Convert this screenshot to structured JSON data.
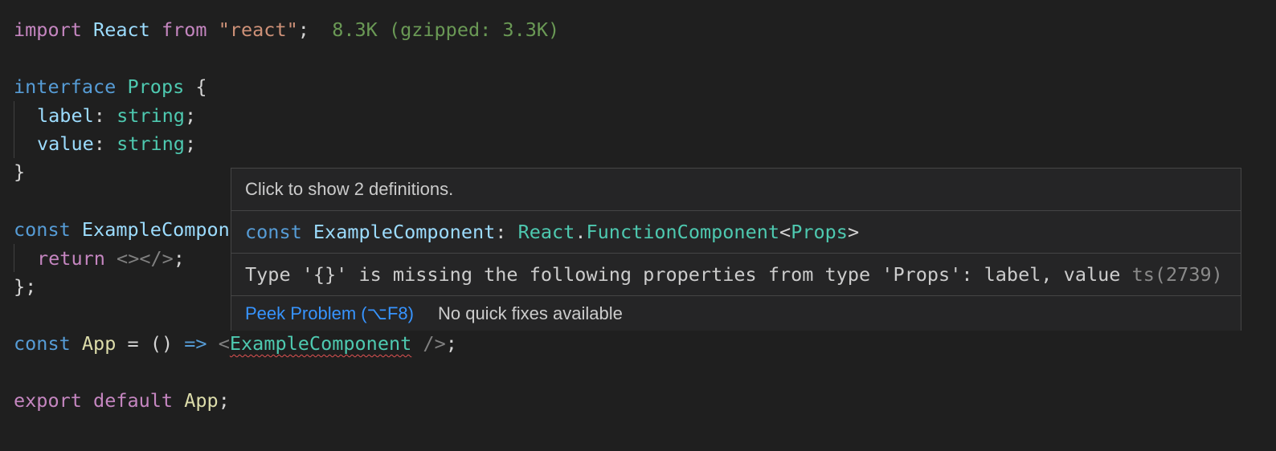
{
  "editor": {
    "lines": {
      "l1": {
        "kw": "import",
        "ident": "React",
        "from": "from",
        "str": "\"react\"",
        "semi": ";",
        "size_hint": "8.3K (gzipped: 3.3K)"
      },
      "l3": {
        "kw": "interface",
        "name": "Props",
        "brace": "{"
      },
      "l4": {
        "prop": "label",
        "colon": ":",
        "type": "string",
        "semi": ";"
      },
      "l5": {
        "prop": "value",
        "colon": ":",
        "type": "string",
        "semi": ";"
      },
      "l6": {
        "brace": "}"
      },
      "l8": {
        "kw": "const",
        "name": "ExampleCompon"
      },
      "l9": {
        "kw": "return",
        "frag": "<></>",
        "semi": ";"
      },
      "l10": {
        "close": "};"
      },
      "l12": {
        "kw": "const",
        "name": "App",
        "eq": "=",
        "parens": "()",
        "arrow": "=>",
        "open": "<",
        "component": "ExampleComponent",
        "close": "/>",
        "semi": ";"
      },
      "l14": {
        "kw1": "export",
        "kw2": "default",
        "name": "App",
        "semi": ";"
      }
    }
  },
  "hover": {
    "hint": "Click to show 2 definitions.",
    "signature": {
      "kw": "const",
      "name": "ExampleComponent",
      "colon": ":",
      "ns": "React",
      "dot": ".",
      "type": "FunctionComponent",
      "lt": "<",
      "generic": "Props",
      "gt": ">"
    },
    "message": "Type '{}' is missing the following properties from type 'Props': label, value",
    "code": "ts(2739)",
    "actions": {
      "peek": "Peek Problem (⌥F8)",
      "no_fix": "No quick fixes available"
    }
  },
  "colors": {
    "background": "#1f1f1f",
    "hover_background": "#252526",
    "link": "#3794ff",
    "error_squiggle": "#e05252"
  }
}
